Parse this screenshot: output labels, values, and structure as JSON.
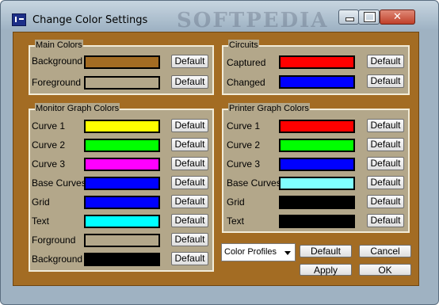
{
  "window": {
    "title": "Change Color Settings",
    "watermark": "SOFTPEDIA"
  },
  "main_colors": {
    "title": "Main Colors",
    "rows": [
      {
        "label": "Background",
        "color": "#a36c23",
        "button": "Default"
      },
      {
        "label": "Foreground",
        "color": "#b3a78a",
        "button": "Default"
      }
    ]
  },
  "circuits": {
    "title": "Circuits",
    "rows": [
      {
        "label": "Captured",
        "color": "#ff0000",
        "button": "Default"
      },
      {
        "label": "Changed",
        "color": "#0000ff",
        "button": "Default"
      }
    ]
  },
  "monitor": {
    "title": "Monitor Graph Colors",
    "rows": [
      {
        "label": "Curve 1",
        "color": "#ffff00",
        "button": "Default"
      },
      {
        "label": "Curve 2",
        "color": "#00ff00",
        "button": "Default"
      },
      {
        "label": "Curve 3",
        "color": "#ff00ff",
        "button": "Default"
      },
      {
        "label": "Base Curves",
        "color": "#0000ff",
        "button": "Default"
      },
      {
        "label": "Grid",
        "color": "#0000ff",
        "button": "Default"
      },
      {
        "label": "Text",
        "color": "#00ffff",
        "button": "Default"
      },
      {
        "label": "Forground",
        "color": "#b3a78a",
        "button": "Default"
      },
      {
        "label": "Background",
        "color": "#000000",
        "button": "Default"
      }
    ]
  },
  "printer": {
    "title": "Printer Graph Colors",
    "rows": [
      {
        "label": "Curve 1",
        "color": "#ff0000",
        "button": "Default"
      },
      {
        "label": "Curve 2",
        "color": "#00ff00",
        "button": "Default"
      },
      {
        "label": "Curve 3",
        "color": "#0000ff",
        "button": "Default"
      },
      {
        "label": "Base Curves",
        "color": "#80ffff",
        "button": "Default"
      },
      {
        "label": "Grid",
        "color": "#000000",
        "button": "Default"
      },
      {
        "label": "Text",
        "color": "#000000",
        "button": "Default"
      }
    ]
  },
  "footer": {
    "profile_select": "Color Profiles",
    "default_button": "Default",
    "cancel_button": "Cancel",
    "apply_button": "Apply",
    "ok_button": "OK"
  }
}
